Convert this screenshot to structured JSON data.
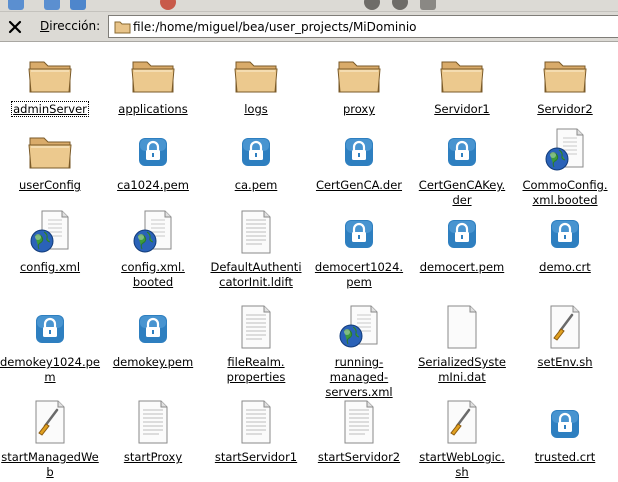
{
  "address_bar": {
    "label_underlined": "D",
    "label_rest": "irección:",
    "value": "file:/home/miguel/bea/user_projects/MiDominio"
  },
  "colors": {
    "folder": "#e8c48a",
    "lock_blue": "#2e7fc0",
    "chrome": "#dcdad5"
  },
  "files": [
    {
      "name": "adminServer",
      "icon": "folder-icon",
      "selected": true
    },
    {
      "name": "applications",
      "icon": "folder-icon"
    },
    {
      "name": "logs",
      "icon": "folder-icon"
    },
    {
      "name": "proxy",
      "icon": "folder-icon"
    },
    {
      "name": "Servidor1",
      "icon": "folder-icon"
    },
    {
      "name": "Servidor2",
      "icon": "folder-icon"
    },
    {
      "name": "userConfig",
      "icon": "folder-icon"
    },
    {
      "name": "ca1024.pem",
      "icon": "lock-icon"
    },
    {
      "name": "ca.pem",
      "icon": "lock-icon"
    },
    {
      "name": "CertGenCA.der",
      "icon": "lock-icon"
    },
    {
      "name": "CertGenCAKey.der",
      "icon": "lock-icon"
    },
    {
      "name": "CommoConfig.xml.booted",
      "icon": "globe-document-icon"
    },
    {
      "name": "config.xml",
      "icon": "globe-document-icon"
    },
    {
      "name": "config.xml.booted",
      "icon": "globe-document-icon"
    },
    {
      "name": "DefaultAuthenticatorInit.ldift",
      "icon": "text-document-icon"
    },
    {
      "name": "democert1024.pem",
      "icon": "lock-icon"
    },
    {
      "name": "democert.pem",
      "icon": "lock-icon"
    },
    {
      "name": "demo.crt",
      "icon": "lock-icon"
    },
    {
      "name": "demokey1024.pem",
      "icon": "lock-icon"
    },
    {
      "name": "demokey.pem",
      "icon": "lock-icon"
    },
    {
      "name": "fileRealm.properties",
      "icon": "text-document-icon"
    },
    {
      "name": "running-managed-servers.xml",
      "icon": "globe-document-icon"
    },
    {
      "name": "SerializedSystemIni.dat",
      "icon": "blank-document-icon"
    },
    {
      "name": "setEnv.sh",
      "icon": "script-icon"
    },
    {
      "name": "startManagedWebLogic.sh",
      "icon": "script-icon"
    },
    {
      "name": "startProxy",
      "icon": "text-document-icon"
    },
    {
      "name": "startServidor1",
      "icon": "text-document-icon"
    },
    {
      "name": "startServidor2",
      "icon": "text-document-icon"
    },
    {
      "name": "startWebLogic.sh",
      "icon": "script-icon"
    },
    {
      "name": "trusted.crt",
      "icon": "lock-icon"
    }
  ]
}
